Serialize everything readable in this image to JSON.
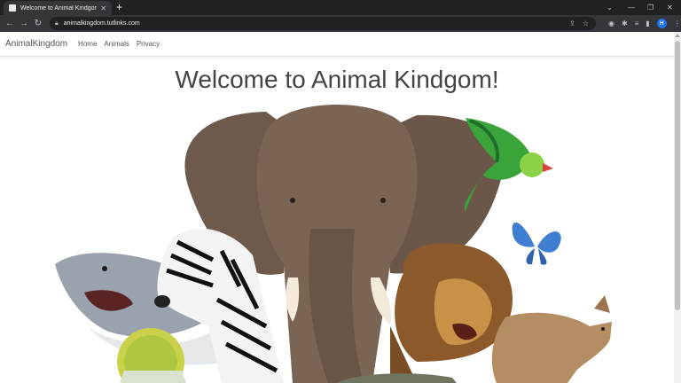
{
  "browser": {
    "tab_title": "Welcome to Animal Kindgom! - /",
    "new_tab_icon": "plus-icon",
    "url": "animalkingdom.tutlinks.com",
    "profile_initial": "H"
  },
  "site": {
    "brand": "AnimalKingdom",
    "nav": [
      "Home",
      "Animals",
      "Privacy"
    ],
    "headline": "Welcome to Animal Kindgom!"
  },
  "colors": {
    "chrome_dark": "#202124",
    "chrome_toolbar": "#35363a",
    "profile_blue": "#1a73e8",
    "elephant": "#6e5a4c",
    "lion": "#b07a36",
    "parrot": "#4caf3a",
    "butterfly": "#3f7ed1"
  }
}
